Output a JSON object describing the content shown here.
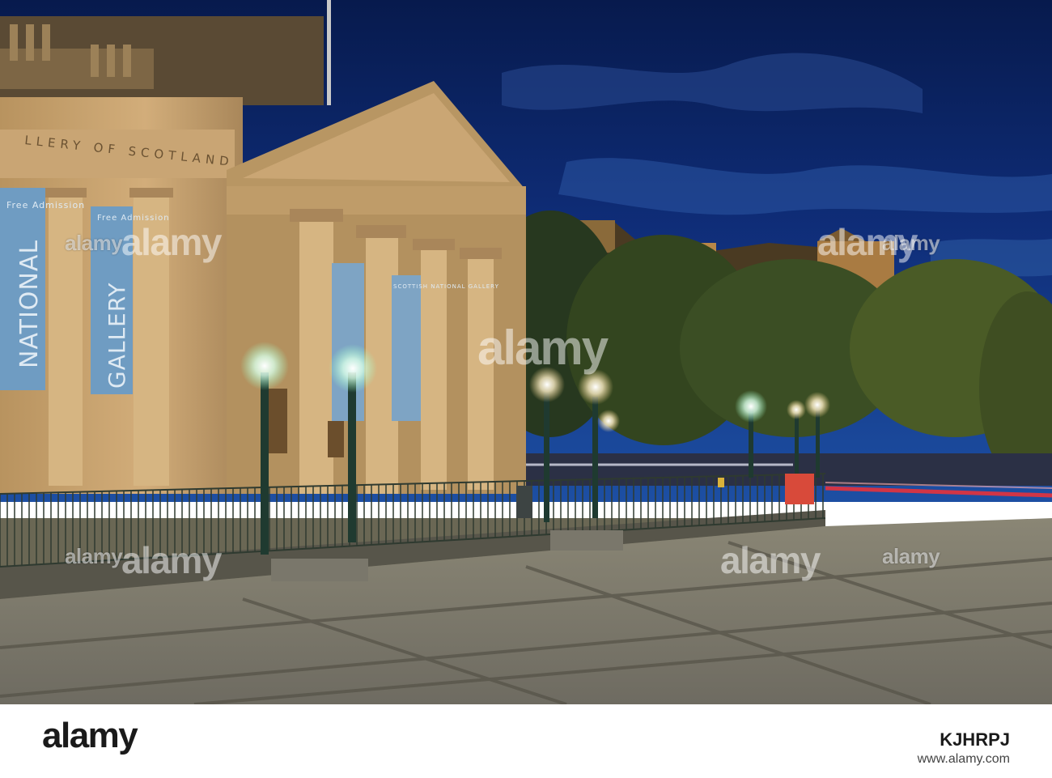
{
  "photo": {
    "frieze_text": "LLERY OF SCOTLAND",
    "banner_left": {
      "top": "Free Admission",
      "main": "NATIONAL"
    },
    "banner_mid": {
      "top": "Free Admission",
      "main": "GALLERY"
    },
    "banner_small": "SCOTTISH NATIONAL GALLERY",
    "sky_color": "#0f2d78",
    "stone_color": "#c9a574"
  },
  "watermark": {
    "text": "alamy"
  },
  "footer": {
    "logo": "alamy",
    "image_id": "KJHRPJ",
    "url": "www.alamy.com"
  }
}
